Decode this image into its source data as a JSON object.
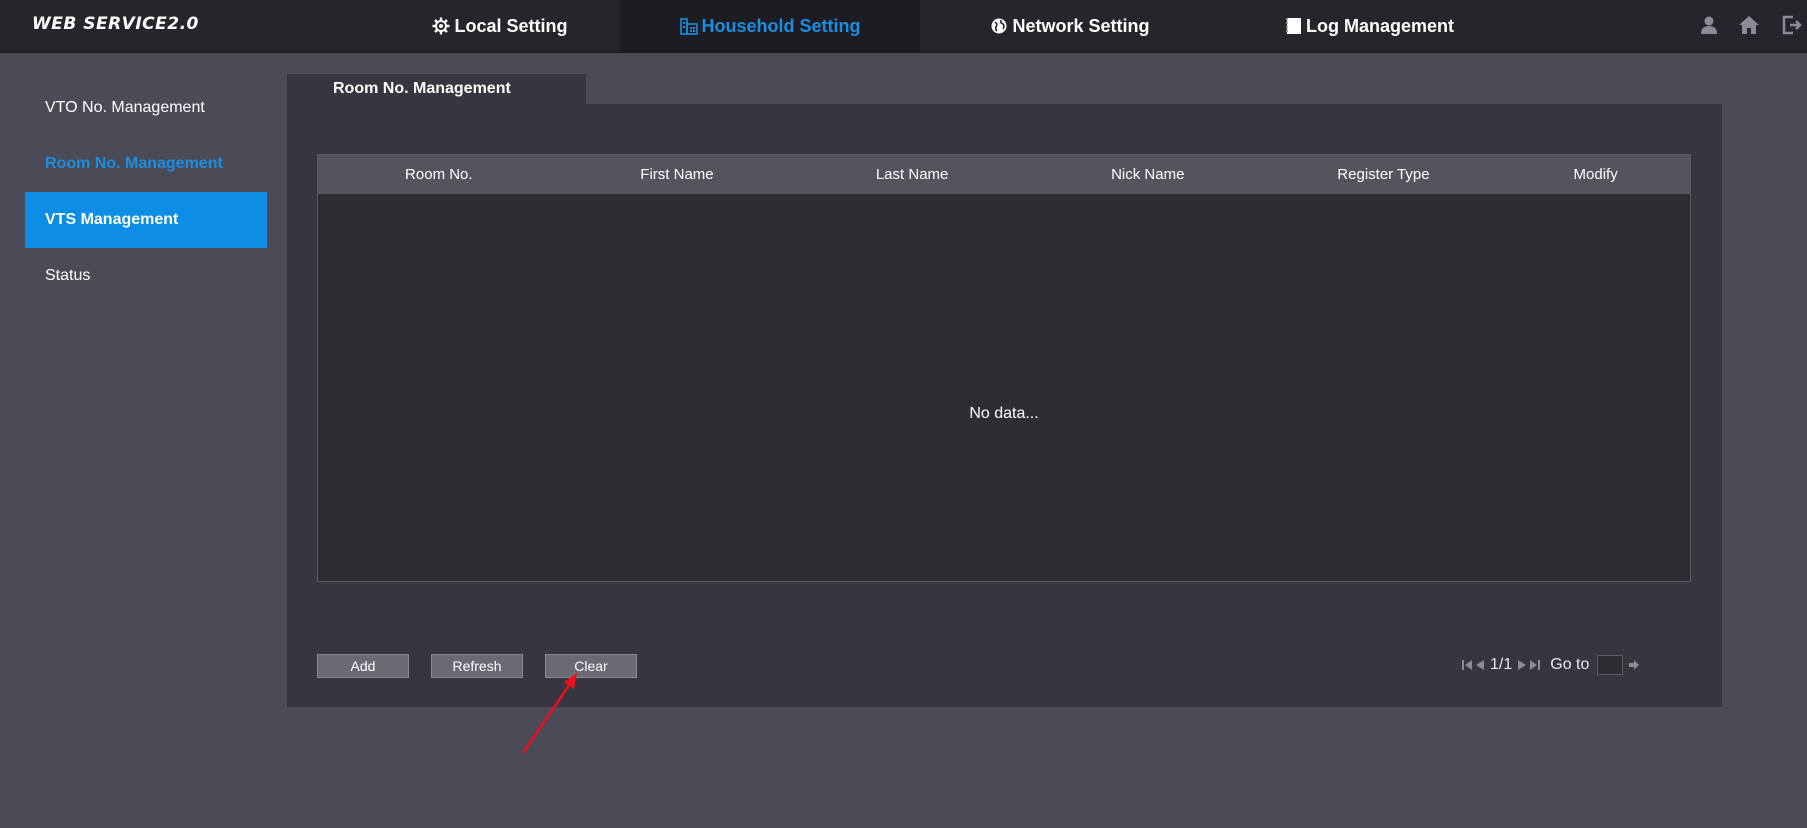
{
  "brand": "WEB SERVICE2.0",
  "nav": {
    "local": "Local Setting",
    "household": "Household Setting",
    "network": "Network Setting",
    "log": "Log Management"
  },
  "top_icons": [
    "user-icon",
    "home-icon",
    "logout-icon"
  ],
  "sidebar": {
    "items": [
      {
        "label": "VTO No. Management"
      },
      {
        "label": "Room No. Management"
      },
      {
        "label": "VTS Management"
      },
      {
        "label": "Status"
      }
    ]
  },
  "panel": {
    "tab_title": "Room No. Management",
    "columns": [
      "Room No.",
      "First Name",
      "Last Name",
      "Nick Name",
      "Register Type",
      "Modify"
    ],
    "no_data": "No data..."
  },
  "buttons": {
    "add": "Add",
    "refresh": "Refresh",
    "clear": "Clear"
  },
  "pagination": {
    "page": "1/1",
    "goto_label": "Go to",
    "goto_value": ""
  },
  "colors": {
    "accent": "#1a8ee0",
    "sidebar_highlight": "#0d8ee4",
    "annotation_arrow": "#e8101a"
  }
}
